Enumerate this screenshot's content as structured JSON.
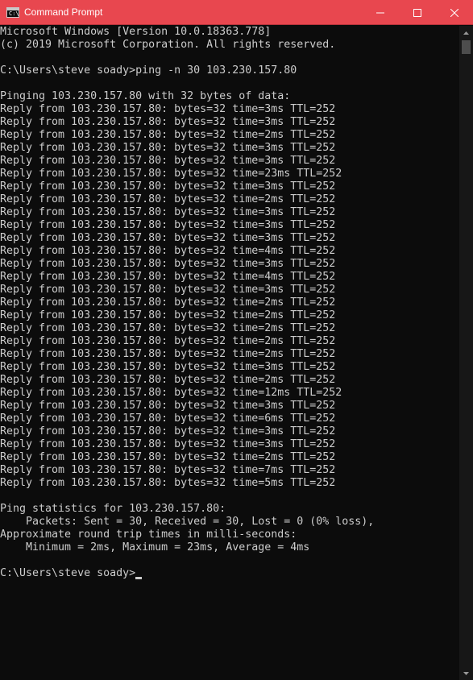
{
  "window": {
    "title": "Command Prompt",
    "icon": "cmd-icon",
    "controls": [
      "minimize-icon",
      "maximize-icon",
      "close-icon"
    ],
    "titlebar_color": "#e8474f"
  },
  "console": {
    "background": "#0c0c0c",
    "foreground": "#cccccc",
    "lines": [
      "Microsoft Windows [Version 10.0.18363.778]",
      "(c) 2019 Microsoft Corporation. All rights reserved.",
      "",
      "C:\\Users\\steve soady>ping -n 30 103.230.157.80",
      "",
      "Pinging 103.230.157.80 with 32 bytes of data:",
      "Reply from 103.230.157.80: bytes=32 time=3ms TTL=252",
      "Reply from 103.230.157.80: bytes=32 time=3ms TTL=252",
      "Reply from 103.230.157.80: bytes=32 time=2ms TTL=252",
      "Reply from 103.230.157.80: bytes=32 time=3ms TTL=252",
      "Reply from 103.230.157.80: bytes=32 time=3ms TTL=252",
      "Reply from 103.230.157.80: bytes=32 time=23ms TTL=252",
      "Reply from 103.230.157.80: bytes=32 time=3ms TTL=252",
      "Reply from 103.230.157.80: bytes=32 time=2ms TTL=252",
      "Reply from 103.230.157.80: bytes=32 time=3ms TTL=252",
      "Reply from 103.230.157.80: bytes=32 time=3ms TTL=252",
      "Reply from 103.230.157.80: bytes=32 time=3ms TTL=252",
      "Reply from 103.230.157.80: bytes=32 time=4ms TTL=252",
      "Reply from 103.230.157.80: bytes=32 time=3ms TTL=252",
      "Reply from 103.230.157.80: bytes=32 time=4ms TTL=252",
      "Reply from 103.230.157.80: bytes=32 time=3ms TTL=252",
      "Reply from 103.230.157.80: bytes=32 time=2ms TTL=252",
      "Reply from 103.230.157.80: bytes=32 time=2ms TTL=252",
      "Reply from 103.230.157.80: bytes=32 time=2ms TTL=252",
      "Reply from 103.230.157.80: bytes=32 time=2ms TTL=252",
      "Reply from 103.230.157.80: bytes=32 time=2ms TTL=252",
      "Reply from 103.230.157.80: bytes=32 time=3ms TTL=252",
      "Reply from 103.230.157.80: bytes=32 time=2ms TTL=252",
      "Reply from 103.230.157.80: bytes=32 time=12ms TTL=252",
      "Reply from 103.230.157.80: bytes=32 time=3ms TTL=252",
      "Reply from 103.230.157.80: bytes=32 time=6ms TTL=252",
      "Reply from 103.230.157.80: bytes=32 time=3ms TTL=252",
      "Reply from 103.230.157.80: bytes=32 time=3ms TTL=252",
      "Reply from 103.230.157.80: bytes=32 time=2ms TTL=252",
      "Reply from 103.230.157.80: bytes=32 time=7ms TTL=252",
      "Reply from 103.230.157.80: bytes=32 time=5ms TTL=252",
      "",
      "Ping statistics for 103.230.157.80:",
      "    Packets: Sent = 30, Received = 30, Lost = 0 (0% loss),",
      "Approximate round trip times in milli-seconds:",
      "    Minimum = 2ms, Maximum = 23ms, Average = 4ms",
      ""
    ],
    "prompt": "C:\\Users\\steve soady>"
  }
}
